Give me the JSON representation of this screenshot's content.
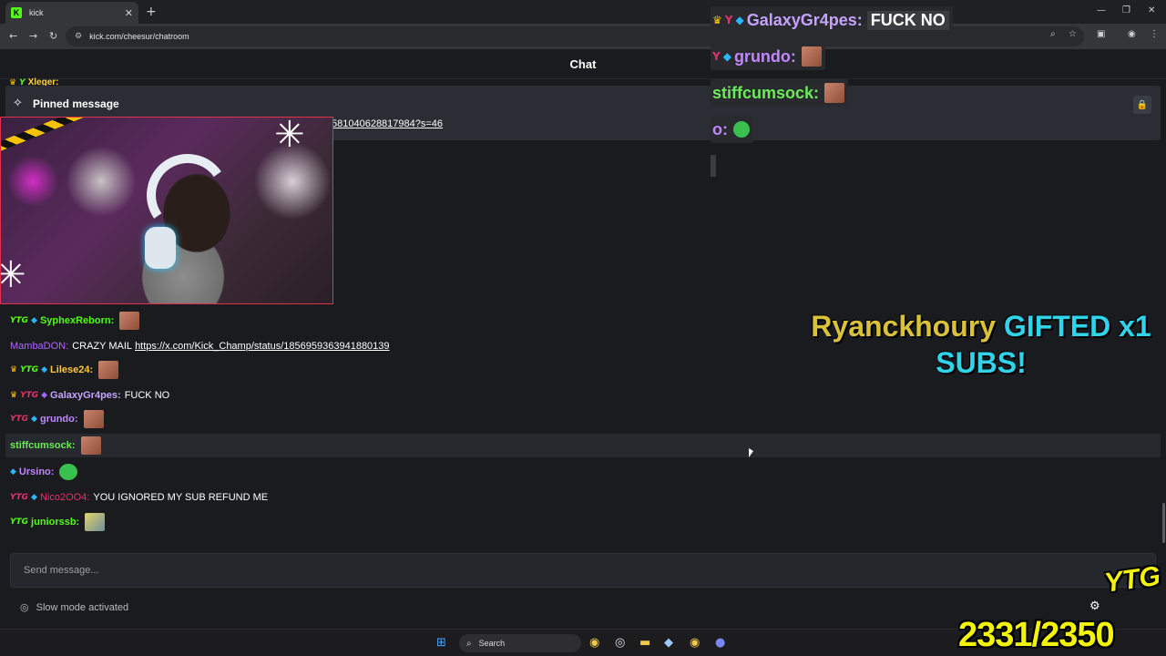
{
  "browser": {
    "tab_title": "kick",
    "tab_favicon": "K",
    "new_tab_icon": "+",
    "url": "kick.com/cheesur/chatroom"
  },
  "chat": {
    "header_title": "Chat",
    "behind_message_user": "Xleger:",
    "pinned": {
      "title": "Pinned message",
      "link_fragment": "581040628817984?s=46"
    },
    "messages": [
      {
        "badges": [
          "ytg",
          "cube"
        ],
        "user": "SyphexReborn:",
        "user_color": "#53fc18",
        "text": "",
        "emote": "face"
      },
      {
        "badges": [],
        "user": "MambaDON:",
        "user_color": "#b266ff",
        "text": "CRAZY MAIL",
        "link": "https://x.com/Kick_Champ/status/1856959363941880139"
      },
      {
        "badges": [
          "crown",
          "ytg",
          "cube"
        ],
        "user": "Lilese24:",
        "user_color": "#ffc83d",
        "text": "",
        "emote": "face"
      },
      {
        "badges": [
          "crown",
          "ytg-red",
          "cube-purple"
        ],
        "user": "GalaxyGr4pes:",
        "user_color": "#c6a3ff",
        "text": "FUCK NO"
      },
      {
        "badges": [
          "ytg-red",
          "cube"
        ],
        "user": "grundo:",
        "user_color": "#c286ff",
        "text": "",
        "emote": "face"
      },
      {
        "badges": [],
        "user": "stiffcumsock:",
        "user_color": "#6dea5a",
        "text": "",
        "emote": "face",
        "highlight": true
      },
      {
        "badges": [
          "cube"
        ],
        "user": "Ursino:",
        "user_color": "#c286ff",
        "text": "",
        "emote": "green"
      },
      {
        "badges": [
          "ytg-red",
          "cube"
        ],
        "user": "Nico2OO4:",
        "user_color": "#e8336a",
        "text": "YOU IGNORED MY SUB REFUND ME"
      },
      {
        "badges": [
          "ytg"
        ],
        "user": "juniorssb:",
        "user_color": "#53fc18",
        "text": "",
        "emote": "yellow"
      }
    ],
    "input_placeholder": "Send message...",
    "slow_mode_text": "Slow mode activated"
  },
  "taskbar": {
    "search_label": "Search"
  },
  "overlay": {
    "rows": [
      {
        "user": "GalaxyGr4pes:",
        "user_color": "#c6a3ff",
        "text": "FUCK NO"
      },
      {
        "user": "grundo:",
        "user_color": "#c286ff",
        "text": ""
      },
      {
        "user": "stiffcumsock:",
        "user_color": "#6dea5a",
        "text": ""
      },
      {
        "user": "o:",
        "user_color": "#c286ff",
        "text": ""
      }
    ],
    "gift_name": "Ryanckhoury",
    "gift_mid": "GIFTED x1",
    "gift_tail": "SUBS!",
    "logo_text": "YTG",
    "counter": "2331/2350"
  },
  "colors": {
    "accent": "#53fc18",
    "background": "#191b1f",
    "panel": "#2a2d33"
  }
}
